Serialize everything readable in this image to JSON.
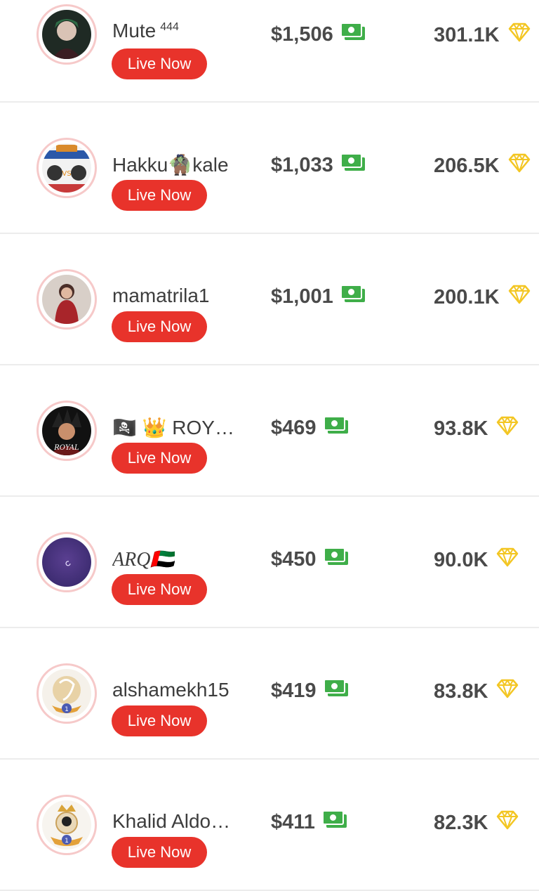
{
  "rows": [
    {
      "name": "Mute",
      "name_suffix": "444",
      "live_label": "Live Now",
      "amount": "$1,506",
      "diamonds": "301.1K"
    },
    {
      "name": "Hakku🧌kale",
      "live_label": "Live Now",
      "amount": "$1,033",
      "diamonds": "206.5K"
    },
    {
      "name": "mamatrila1",
      "live_label": "Live Now",
      "amount": "$1,001",
      "diamonds": "200.1K"
    },
    {
      "name": "🏴‍☠️ 👑 ROY…",
      "live_label": "Live Now",
      "amount": "$469",
      "diamonds": "93.8K"
    },
    {
      "name": "ARQ🇦🇪",
      "live_label": "Live Now",
      "amount": "$450",
      "diamonds": "90.0K"
    },
    {
      "name": "alshamekh15",
      "live_label": "Live Now",
      "amount": "$419",
      "diamonds": "83.8K"
    },
    {
      "name": "Khalid Aldo…",
      "live_label": "Live Now",
      "amount": "$411",
      "diamonds": "82.3K"
    }
  ],
  "icons": {
    "money": "cash-icon",
    "diamond": "diamond-icon"
  },
  "colors": {
    "live_button": "#e8332b",
    "cash_icon": "#3fae49",
    "diamond_icon": "#f3c623",
    "avatar_ring": "#f6c9c9"
  }
}
